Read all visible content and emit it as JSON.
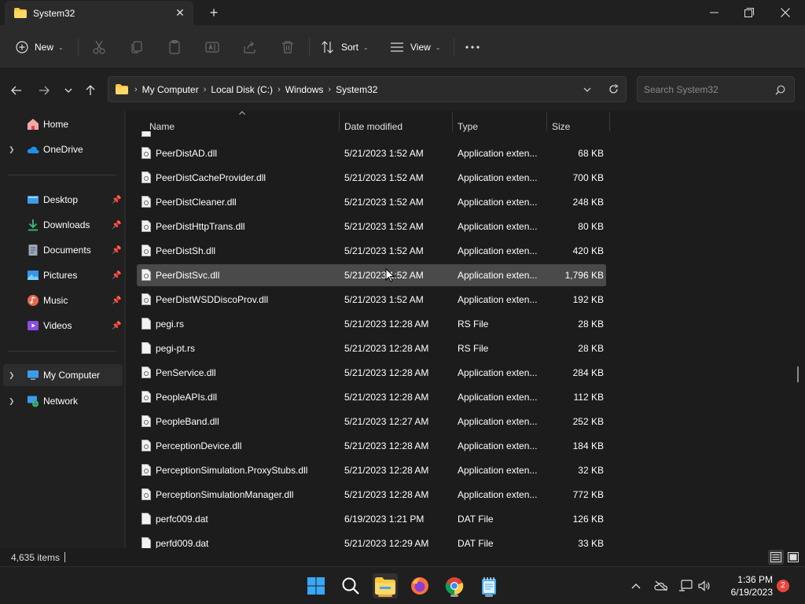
{
  "window": {
    "tab_title": "System32",
    "new_tab_icon": "plus-icon",
    "controls": [
      "minimize-icon",
      "maximize-icon",
      "close-icon"
    ]
  },
  "toolbar": {
    "new_label": "New",
    "sort_label": "Sort",
    "view_label": "View",
    "icons": [
      "cut-icon",
      "copy-icon",
      "paste-icon",
      "rename-icon",
      "share-icon",
      "delete-icon",
      "more-icon"
    ]
  },
  "address": {
    "crumbs": [
      "My Computer",
      "Local Disk (C:)",
      "Windows",
      "System32"
    ],
    "search_placeholder": "Search System32"
  },
  "sidebar": {
    "items": [
      {
        "label": "Home",
        "icon": "home-icon"
      },
      {
        "label": "OneDrive",
        "icon": "cloud-icon"
      },
      {
        "label": "Desktop",
        "icon": "desktop-icon"
      },
      {
        "label": "Downloads",
        "icon": "download-icon"
      },
      {
        "label": "Documents",
        "icon": "document-icon"
      },
      {
        "label": "Pictures",
        "icon": "picture-icon"
      },
      {
        "label": "Music",
        "icon": "music-icon"
      },
      {
        "label": "Videos",
        "icon": "video-icon"
      },
      {
        "label": "My Computer",
        "icon": "computer-icon"
      },
      {
        "label": "Network",
        "icon": "network-icon"
      }
    ]
  },
  "columns": {
    "name": "Name",
    "date": "Date modified",
    "type": "Type",
    "size": "Size"
  },
  "files": [
    {
      "name": "PeerDistAD.dll",
      "date": "5/21/2023 1:52 AM",
      "type": "Application exten...",
      "size": "68 KB"
    },
    {
      "name": "PeerDistCacheProvider.dll",
      "date": "5/21/2023 1:52 AM",
      "type": "Application exten...",
      "size": "700 KB"
    },
    {
      "name": "PeerDistCleaner.dll",
      "date": "5/21/2023 1:52 AM",
      "type": "Application exten...",
      "size": "248 KB"
    },
    {
      "name": "PeerDistHttpTrans.dll",
      "date": "5/21/2023 1:52 AM",
      "type": "Application exten...",
      "size": "80 KB"
    },
    {
      "name": "PeerDistSh.dll",
      "date": "5/21/2023 1:52 AM",
      "type": "Application exten...",
      "size": "420 KB"
    },
    {
      "name": "PeerDistSvc.dll",
      "date": "5/21/2023 1:52 AM",
      "type": "Application exten...",
      "size": "1,796 KB"
    },
    {
      "name": "PeerDistWSDDiscoProv.dll",
      "date": "5/21/2023 1:52 AM",
      "type": "Application exten...",
      "size": "192 KB"
    },
    {
      "name": "pegi.rs",
      "date": "5/21/2023 12:28 AM",
      "type": "RS File",
      "size": "28 KB"
    },
    {
      "name": "pegi-pt.rs",
      "date": "5/21/2023 12:28 AM",
      "type": "RS File",
      "size": "28 KB"
    },
    {
      "name": "PenService.dll",
      "date": "5/21/2023 12:28 AM",
      "type": "Application exten...",
      "size": "284 KB"
    },
    {
      "name": "PeopleAPIs.dll",
      "date": "5/21/2023 12:28 AM",
      "type": "Application exten...",
      "size": "112 KB"
    },
    {
      "name": "PeopleBand.dll",
      "date": "5/21/2023 12:27 AM",
      "type": "Application exten...",
      "size": "252 KB"
    },
    {
      "name": "PerceptionDevice.dll",
      "date": "5/21/2023 12:28 AM",
      "type": "Application exten...",
      "size": "184 KB"
    },
    {
      "name": "PerceptionSimulation.ProxyStubs.dll",
      "date": "5/21/2023 12:28 AM",
      "type": "Application exten...",
      "size": "32 KB"
    },
    {
      "name": "PerceptionSimulationManager.dll",
      "date": "5/21/2023 12:28 AM",
      "type": "Application exten...",
      "size": "772 KB"
    },
    {
      "name": "perfc009.dat",
      "date": "6/19/2023 1:21 PM",
      "type": "DAT File",
      "size": "126 KB"
    },
    {
      "name": "perfd009.dat",
      "date": "5/21/2023 12:29 AM",
      "type": "DAT File",
      "size": "33 KB"
    }
  ],
  "status": {
    "item_count": "4,635 items"
  },
  "taskbar": {
    "apps": [
      "start-icon",
      "search-icon",
      "file-explorer-icon",
      "firefox-icon",
      "chrome-icon",
      "notepad-icon"
    ],
    "time": "1:36 PM",
    "date": "6/19/2023",
    "notification_count": "2"
  },
  "colors": {
    "accent": "#ffc83d",
    "selection": "#4a4a4a",
    "badge": "#e8453c"
  }
}
